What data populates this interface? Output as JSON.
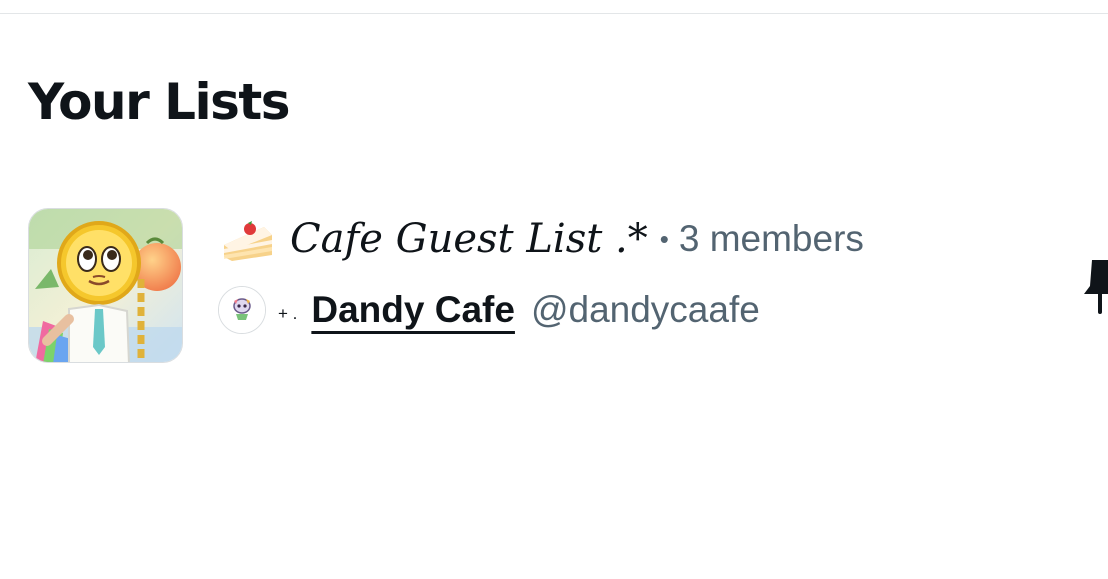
{
  "lists_section": {
    "title": "Your Lists"
  },
  "list_item": {
    "name_emoji": "cake-icon",
    "name": "Cafe Guest List .*",
    "separator": "•",
    "member_count": "3 members",
    "owner": {
      "prefix": "+ .",
      "display_name": "Dandy Cafe",
      "handle": "@dandycaafe"
    }
  },
  "actions": {
    "pin_icon": "pin-icon"
  },
  "colors": {
    "text_primary": "#0f1419",
    "text_secondary": "#536471",
    "divider": "#e3e6e8"
  }
}
